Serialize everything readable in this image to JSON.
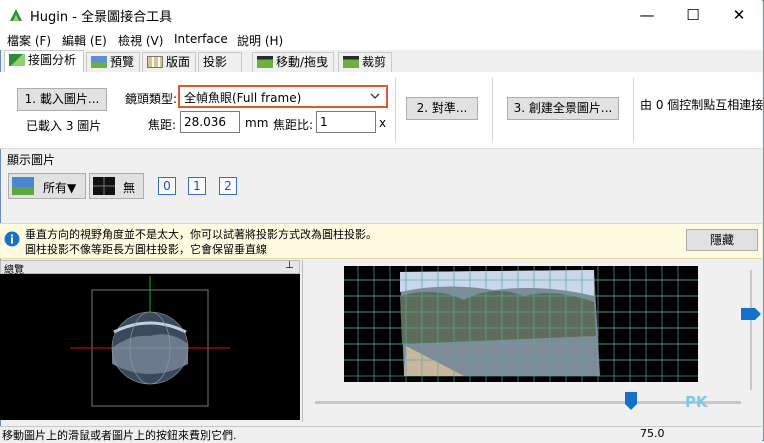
{
  "window": {
    "title": "Hugin - 全景圖接合工具",
    "minimize": "—",
    "maximize": "☐",
    "close": "✕"
  },
  "menu": [
    "檔案 (F)",
    "編輯 (E)",
    "檢視 (V)",
    "Interface",
    "說明 (H)"
  ],
  "tabs": [
    "接圖分析",
    "預覽",
    "版面",
    "投影",
    "移動/拖曳",
    "裁剪"
  ],
  "assistant": {
    "load_button": "1. 載入圖片...",
    "loaded_text": "已載入 3 圖片",
    "lens_type_label": "鏡頭類型:",
    "lens_type_value": "全幀魚眼(Full frame)",
    "focal_label": "焦距:",
    "focal_value": "28.036",
    "focal_unit": "mm",
    "crop_label": "焦距比:",
    "crop_value": "1",
    "crop_unit": "x",
    "align_button": "2. 對準...",
    "create_button": "3. 創建全景圖片...",
    "cp_text": "由 0 個控制點互相連接"
  },
  "display": {
    "heading": "顯示圖片",
    "all_label": "所有▼",
    "none_label": "無",
    "images": [
      "0",
      "1",
      "2"
    ]
  },
  "info": {
    "line1": "垂直方向的視野角度並不是太大，你可以試著將投影方式改為圓柱投影。",
    "line2": "圓柱投影不像等距長方圓柱投影，它會保留垂直線",
    "hide_button": "隱藏"
  },
  "overview": {
    "title": "總覽",
    "pin": "⊥"
  },
  "slider_value": "75.0",
  "status_text": "移動圖片上的滑鼠或者圖片上的按鈕來費別它們.",
  "watermark": "PK",
  "colors": {
    "accent": "#1672c8",
    "highlight": "#e2572b"
  }
}
